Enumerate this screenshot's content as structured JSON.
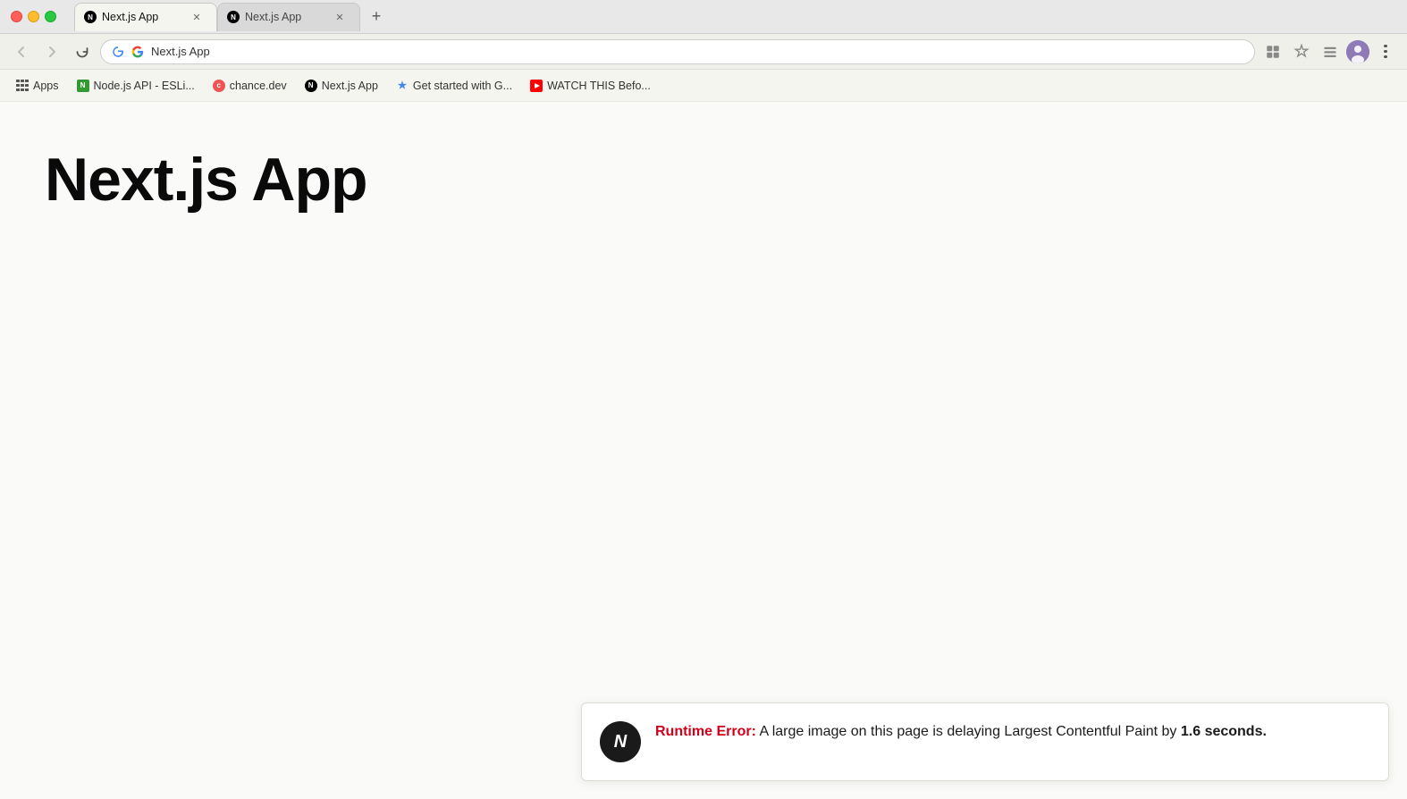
{
  "window": {
    "title": "Next.js App"
  },
  "tabs": [
    {
      "id": "tab1",
      "label": "Next.js App",
      "favicon": "nextjs",
      "active": true,
      "closeable": true
    },
    {
      "id": "tab2",
      "label": "Next.js App",
      "favicon": "nextjs",
      "active": false,
      "closeable": true
    }
  ],
  "nav": {
    "back_disabled": true,
    "forward_disabled": true,
    "reload_label": "↻",
    "url": "Next.js App",
    "url_display": "Next.js App"
  },
  "bookmarks": [
    {
      "id": "apps",
      "label": "Apps",
      "favicon": "grid"
    },
    {
      "id": "nodejs",
      "label": "Node.js API - ESLi...",
      "favicon": "nodejs"
    },
    {
      "id": "chance",
      "label": "chance.dev",
      "favicon": "chance"
    },
    {
      "id": "nextjs",
      "label": "Next.js App",
      "favicon": "nextjs"
    },
    {
      "id": "getstarted",
      "label": "Get started with G...",
      "favicon": "getstarted"
    },
    {
      "id": "watch",
      "label": "WATCH THIS Befo...",
      "favicon": "youtube"
    }
  ],
  "page": {
    "heading": "Next.js App"
  },
  "error": {
    "icon_letter": "N",
    "label": "Runtime Error:",
    "message": " A large image on this page is delaying Largest Contentful Paint by ",
    "highlight": "1.6 seconds."
  }
}
